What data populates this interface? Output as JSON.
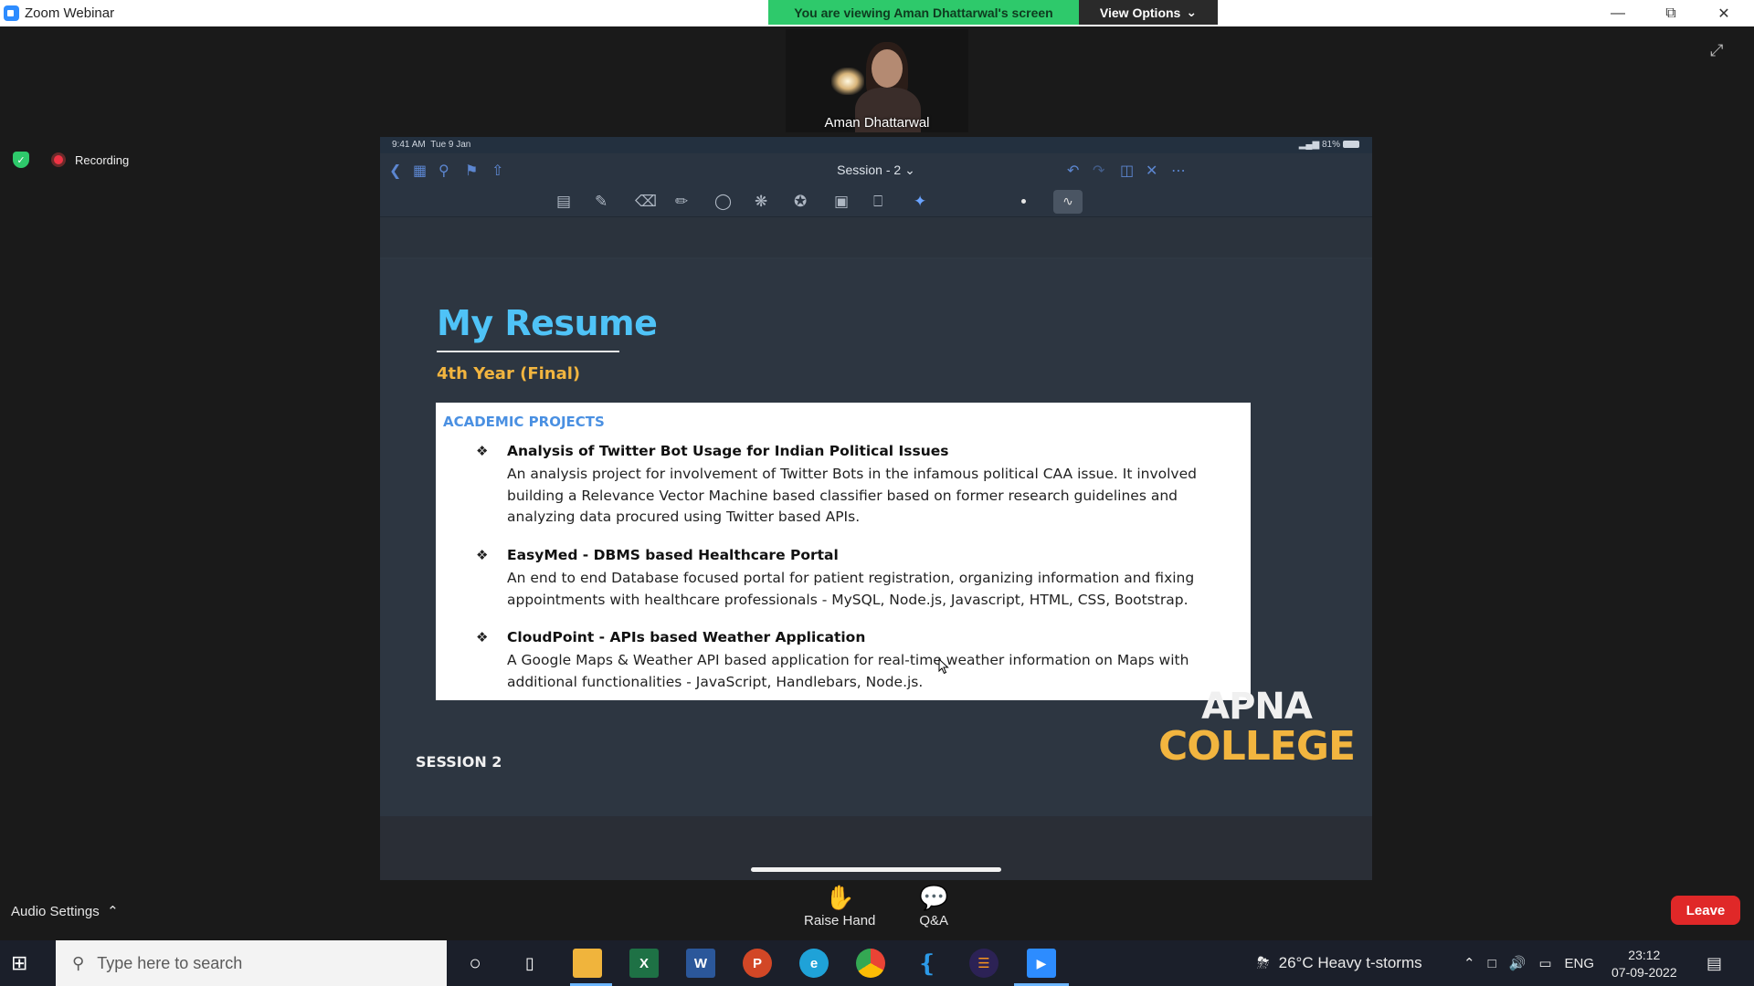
{
  "window": {
    "title": "Zoom Webinar",
    "viewing_banner": "You are viewing Aman Dhattarwal's screen",
    "view_options_label": "View Options"
  },
  "video": {
    "participant_name": "Aman Dhattarwal"
  },
  "recording": {
    "label": "Recording"
  },
  "ipad": {
    "status_time": "9:41 AM",
    "status_date": "Tue 9 Jan",
    "battery": "81%",
    "doc_title": "Session - 2"
  },
  "slide": {
    "title": "My Resume",
    "subtitle": "4th Year (Final)",
    "section_heading": "ACADEMIC PROJECTS",
    "projects": [
      {
        "title": "Analysis of Twitter Bot Usage for Indian Political Issues",
        "description": "An analysis project for involvement of Twitter Bots in the infamous political CAA issue. It involved building a Relevance Vector Machine based classifier based on former research guidelines and analyzing data procured using Twitter based APIs."
      },
      {
        "title": "EasyMed - DBMS based Healthcare Portal",
        "description": "An end to end Database focused portal for patient registration, organizing information and fixing appointments with healthcare professionals - MySQL, Node.js, Javascript, HTML, CSS, Bootstrap."
      },
      {
        "title": "CloudPoint - APIs based Weather Application",
        "description": "A Google Maps & Weather API  based application for real-time weather information on Maps with additional functionalities - JavaScript, Handlebars, Node.js."
      }
    ],
    "session_label": "SESSION 2",
    "logo_line1": "APNA",
    "logo_line2": "COLLEGE"
  },
  "controls": {
    "audio_settings": "Audio Settings",
    "raise_hand": "Raise Hand",
    "qa": "Q&A",
    "leave": "Leave"
  },
  "taskbar": {
    "search_placeholder": "Type here to search",
    "weather": "26°C  Heavy t-storms",
    "language": "ENG",
    "time": "23:12",
    "date": "07-09-2022",
    "apps": [
      "file-explorer",
      "excel",
      "word",
      "powerpoint",
      "edge",
      "chrome",
      "vscode",
      "eclipse",
      "zoom"
    ]
  },
  "colors": {
    "banner_green": "#2ec96b",
    "leave_red": "#e02828",
    "slide_title": "#4fc3f7",
    "slide_accent": "#f2b53f",
    "card_heading": "#4a90e2"
  }
}
